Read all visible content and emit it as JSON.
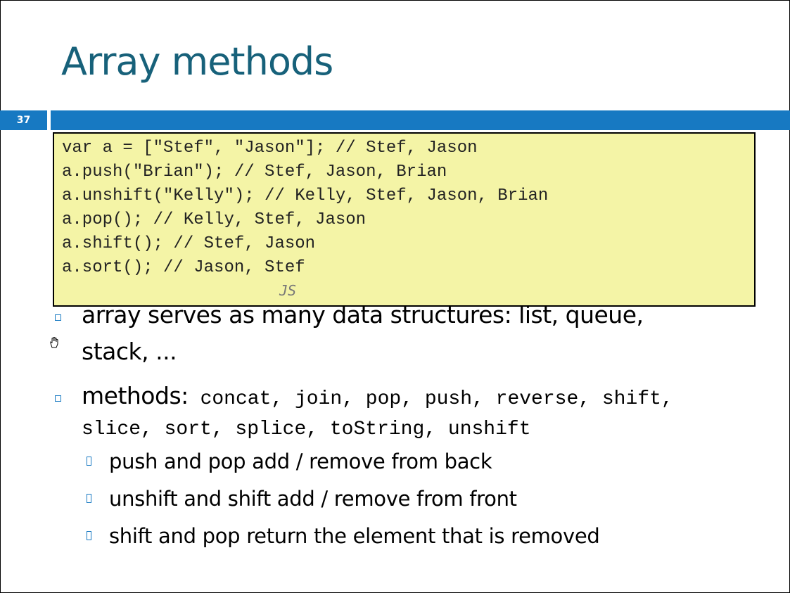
{
  "slide": {
    "title": "Array methods",
    "number": "37"
  },
  "code": {
    "lines": [
      "var a = [\"Stef\", \"Jason\"]; // Stef, Jason",
      "a.push(\"Brian\"); // Stef, Jason, Brian",
      "a.unshift(\"Kelly\"); // Kelly, Stef, Jason, Brian",
      "a.pop(); // Kelly, Stef, Jason",
      "a.shift(); // Stef, Jason",
      "a.sort(); // Jason, Stef"
    ],
    "language_label": "JS"
  },
  "bullets": {
    "b1_line1": "array serves as many data structures: list, queue,",
    "b1_line2": "stack, ...",
    "b2_label": "methods:",
    "b2_line1_methods": " concat, join, pop, push, reverse, shift,",
    "b2_line2_methods": "slice, sort, splice, toString, unshift",
    "sub": [
      "push and pop add / remove from back",
      "unshift and shift add / remove from front",
      "shift and pop return the element that is removed"
    ]
  },
  "colors": {
    "title": "#17617a",
    "accent_bar": "#1779c2",
    "code_background": "#f4f4a6"
  },
  "icons": {
    "cursor": "hand-cursor-icon",
    "bullet": "square-bullet-icon"
  }
}
